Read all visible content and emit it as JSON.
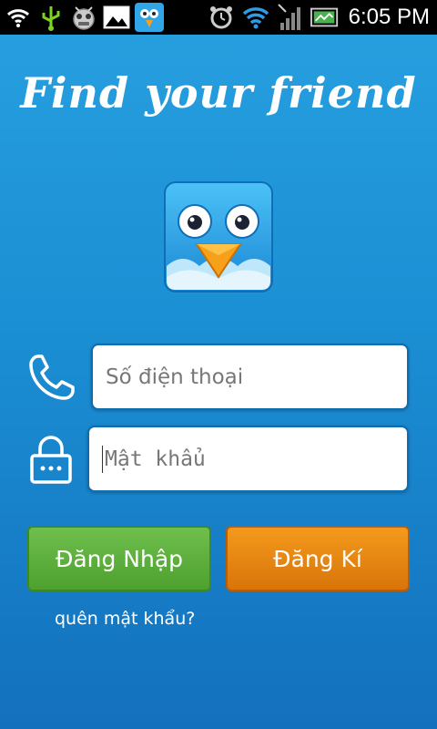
{
  "status_bar": {
    "time": "6:05 PM",
    "icons": [
      "wifi-icon",
      "usb-icon",
      "bug-icon",
      "image-icon",
      "app-notification-icon",
      "alarm-icon",
      "wifi-signal-icon",
      "cellular-signal-icon",
      "battery-icon"
    ]
  },
  "screen": {
    "headline": "Find your friend",
    "phone_placeholder": "Số điện thoại",
    "password_placeholder": "Mật khẩu",
    "login_button": "Đăng Nhập",
    "register_button": "Đăng Kí",
    "forgot_password_link": "quên mật khẩu?"
  },
  "colors": {
    "background": "#1b8fd3",
    "login_button": "#5aaf3a",
    "register_button": "#e8860f"
  }
}
